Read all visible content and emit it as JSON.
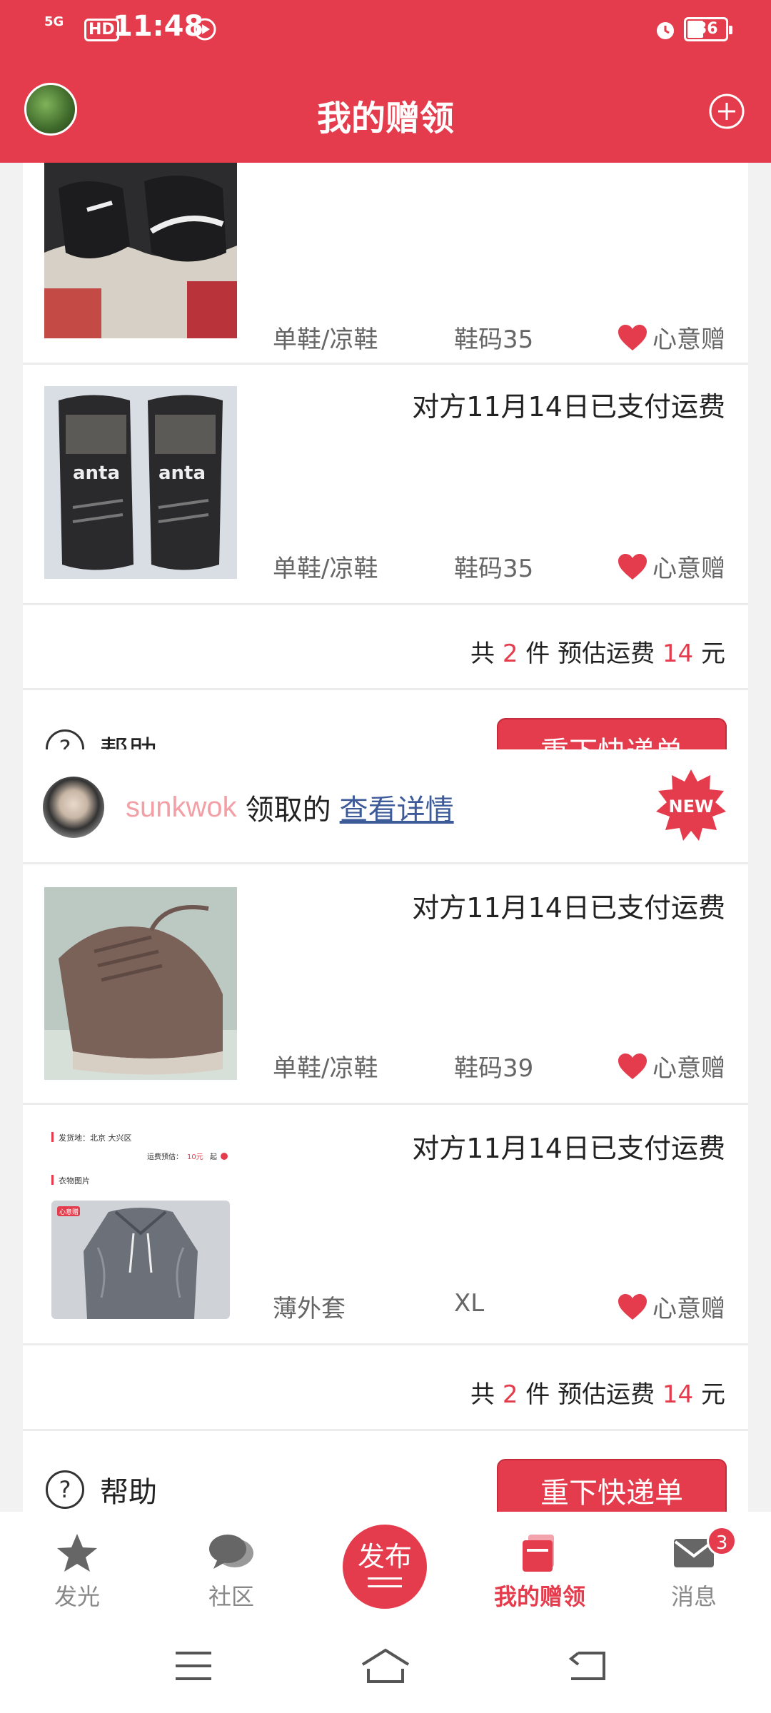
{
  "status_bar": {
    "network": "5G",
    "hd": "HD",
    "time": "11:48",
    "battery": "36"
  },
  "header": {
    "title": "我的赠领"
  },
  "colors": {
    "brand": "#e53c4d",
    "link": "#3d5a99",
    "username": "#f2a0a6"
  },
  "orders": [
    {
      "items": [
        {
          "status": "",
          "category": "单鞋/凉鞋",
          "size": "鞋码35",
          "tag": "心意赠",
          "image_desc": "black-nike-shoes"
        },
        {
          "status": "对方11月14日已支付运费",
          "category": "单鞋/凉鞋",
          "size": "鞋码35",
          "tag": "心意赠",
          "image_desc": "black-anta-shoes"
        }
      ],
      "summary": {
        "prefix": "共",
        "count": "2",
        "mid": "件 预估运费",
        "fee": "14",
        "suffix": "元"
      },
      "help_label": "帮助",
      "action_label": "重下快递单"
    },
    {
      "claimer": {
        "name": "sunkwok",
        "text": "领取的",
        "link": "查看详情",
        "badge": "NEW"
      },
      "items": [
        {
          "status": "对方11月14日已支付运费",
          "category": "单鞋/凉鞋",
          "size": "鞋码39",
          "tag": "心意赠",
          "image_desc": "brown-knit-shoes"
        },
        {
          "status": "对方11月14日已支付运费",
          "category": "薄外套",
          "size": "XL",
          "tag": "心意赠",
          "image_desc": "grey-jacket-listing",
          "image_text": {
            "origin": "发货地：北京 大兴区",
            "fee": "运费预估：",
            "fee_value": "10元",
            "fee_suffix": "起",
            "photos": "衣物图片",
            "stamp": "心意赠"
          }
        }
      ],
      "summary": {
        "prefix": "共",
        "count": "2",
        "mid": "件 预估运费",
        "fee": "14",
        "suffix": "元"
      },
      "help_label": "帮助",
      "action_label": "重下快递单"
    }
  ],
  "bottom_nav": {
    "items": [
      {
        "label": "发光",
        "icon": "star-icon"
      },
      {
        "label": "社区",
        "icon": "chat-bubbles-icon"
      },
      {
        "label": "发布",
        "icon": "publish-button"
      },
      {
        "label": "我的赠领",
        "icon": "gift-box-icon",
        "active": true
      },
      {
        "label": "消息",
        "icon": "mail-icon",
        "badge": "3"
      }
    ]
  }
}
